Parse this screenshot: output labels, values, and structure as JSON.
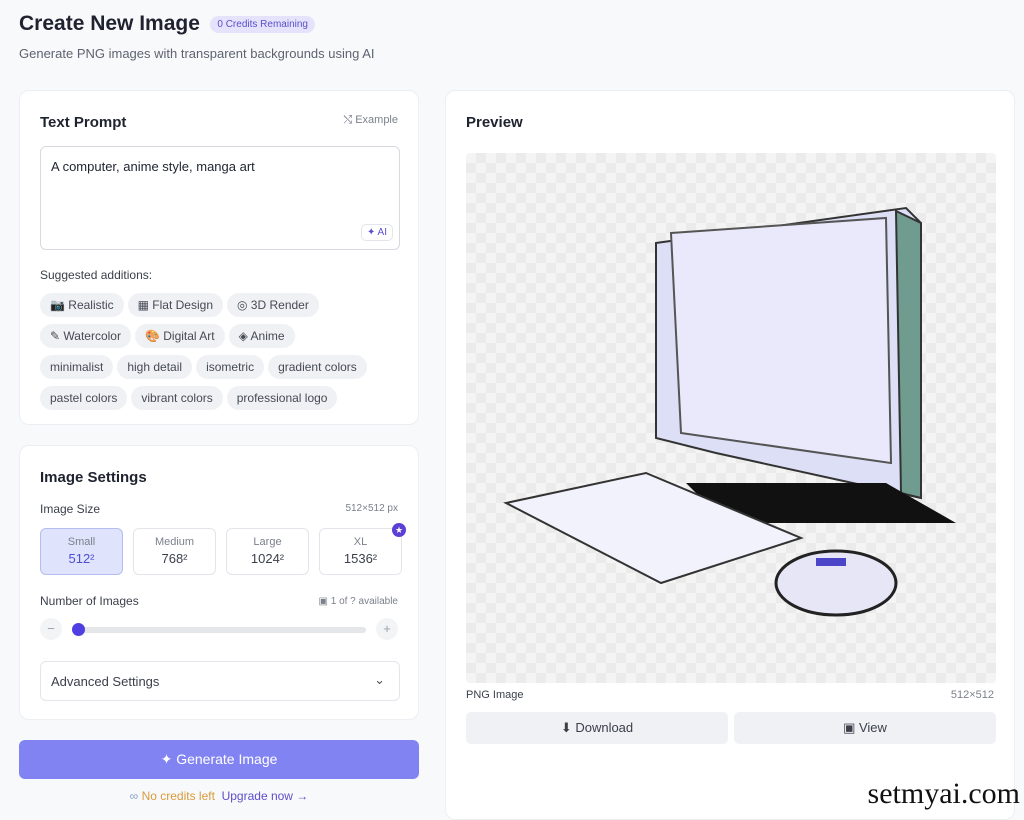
{
  "header": {
    "title": "Create New Image",
    "credits_badge": "0 Credits Remaining",
    "subtitle": "Generate PNG images with transparent backgrounds using AI"
  },
  "prompt": {
    "title": "Text Prompt",
    "example": "⤭ Example",
    "value": "A computer, anime style, manga art",
    "ai_button": "✦ AI",
    "suggested_label": "Suggested additions:",
    "styles": [
      "📷 Realistic",
      "▦ Flat Design",
      "◎ 3D Render",
      "✎ Watercolor",
      "🎨 Digital Art",
      "◈ Anime"
    ],
    "tags": [
      "minimalist",
      "high detail",
      "isometric",
      "gradient colors",
      "pastel colors",
      "vibrant colors",
      "professional logo"
    ]
  },
  "settings": {
    "title": "Image Settings",
    "size_label": "Image Size",
    "size_value": "512×512 px",
    "sizes": [
      {
        "name": "Small",
        "px": "512²",
        "selected": true
      },
      {
        "name": "Medium",
        "px": "768²"
      },
      {
        "name": "Large",
        "px": "1024²"
      },
      {
        "name": "XL",
        "px": "1536²",
        "premium": true
      }
    ],
    "count_label": "Number of Images",
    "count_available": "▣ 1 of ? available",
    "count_value": 1,
    "minus": "−",
    "plus": "+",
    "advanced": "Advanced Settings"
  },
  "generate": {
    "label": "✦ Generate Image",
    "no_credits": "No credits left",
    "upgrade": "Upgrade now →"
  },
  "preview": {
    "title": "Preview",
    "type": "PNG Image",
    "dims": "512×512",
    "download": "⬇ Download",
    "view": "▣ View"
  },
  "watermark": "setmyai.com",
  "colors": {
    "accent": "#5b3fd6",
    "button": "#8183f2",
    "warning": "#d99a3c"
  }
}
